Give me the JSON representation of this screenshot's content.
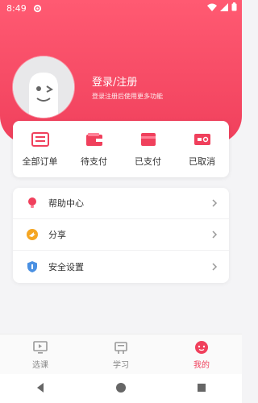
{
  "status_bar": {
    "time": "8:49"
  },
  "profile": {
    "login_title": "登录/注册",
    "login_subtitle": "登录注册后使用更多功能"
  },
  "orders": [
    {
      "label": "全部订单",
      "icon": "order-list-icon"
    },
    {
      "label": "待支付",
      "icon": "wallet-icon"
    },
    {
      "label": "已支付",
      "icon": "card-icon"
    },
    {
      "label": "已取消",
      "icon": "ticket-icon"
    }
  ],
  "menu": [
    {
      "label": "帮助中心",
      "icon": "help-bulb-icon"
    },
    {
      "label": "分享",
      "icon": "share-icon"
    },
    {
      "label": "安全设置",
      "icon": "shield-icon"
    }
  ],
  "tabs": [
    {
      "label": "选课",
      "icon": "monitor-icon",
      "active": false
    },
    {
      "label": "学习",
      "icon": "study-icon",
      "active": false
    },
    {
      "label": "我的",
      "icon": "profile-face-icon",
      "active": true
    }
  ],
  "colors": {
    "accent": "#f0405c",
    "header_gradient_top": "#ff5a72",
    "background": "#f4f4f6"
  }
}
